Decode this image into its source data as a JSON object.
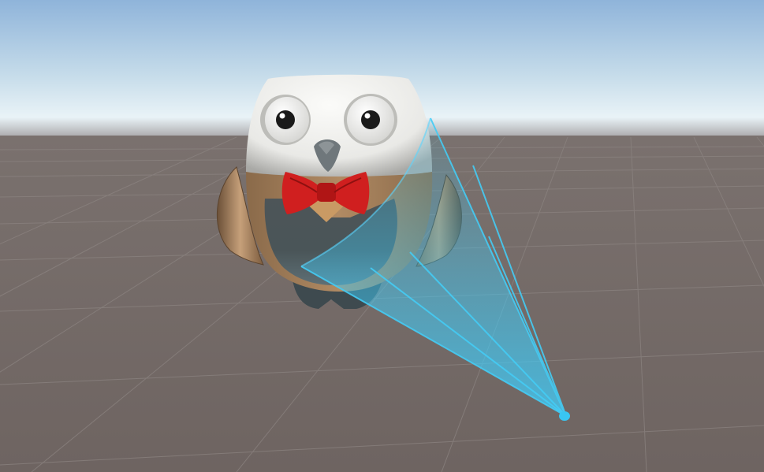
{
  "scene": {
    "view": "unity-scene-view",
    "colors": {
      "sky_top": "#8fb4da",
      "sky_horizon": "#e9f3f7",
      "ground": "#6e6461",
      "grid_line": "#8b8380",
      "gizmo": "#39c6f2",
      "owl_head": "#e9e9e6",
      "owl_body": "#b08a63",
      "owl_belly": "#4a5558",
      "bowtie": "#d01f1f",
      "beak": "#6f777b"
    },
    "objects": [
      {
        "name": "owl-character",
        "parts": [
          "head",
          "eyes",
          "beak",
          "bowtie",
          "body",
          "belly",
          "wings",
          "feet"
        ]
      },
      {
        "name": "spot-light-gizmo",
        "shape": "cone"
      }
    ]
  }
}
